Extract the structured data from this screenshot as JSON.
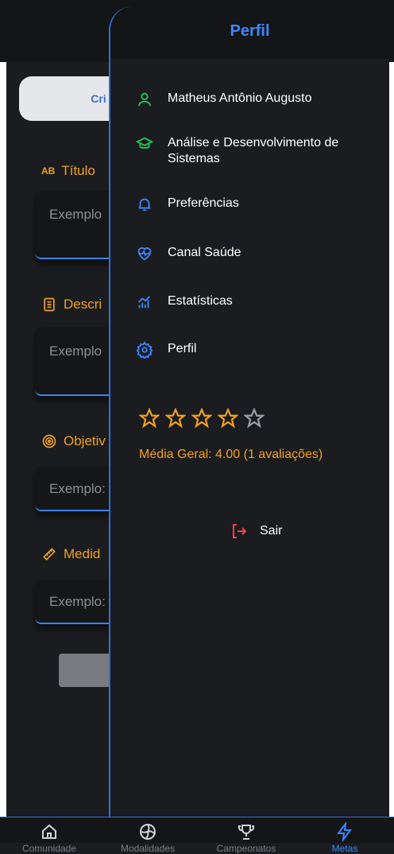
{
  "background_form": {
    "tab_label": "Cri",
    "fields": [
      {
        "label": "Título",
        "placeholder": "Exemplo"
      },
      {
        "label": "Descri",
        "placeholder": "Exemplo"
      },
      {
        "label": "Objetiv",
        "placeholder": "Exemplo:"
      },
      {
        "label": "Medid",
        "placeholder": "Exemplo:"
      }
    ]
  },
  "drawer": {
    "title": "Perfil",
    "items": [
      {
        "icon": "user-icon",
        "label": "Matheus Antônio Augusto"
      },
      {
        "icon": "graduation-cap-icon",
        "label": "Análise e Desenvolvimento de Sistemas"
      },
      {
        "icon": "bell-icon",
        "label": "Preferências"
      },
      {
        "icon": "heart-pulse-icon",
        "label": "Canal Saúde"
      },
      {
        "icon": "stats-icon",
        "label": "Estatísticas"
      },
      {
        "icon": "settings-icon",
        "label": "Perfil"
      }
    ],
    "rating": {
      "stars_filled": 4,
      "stars_total": 5,
      "text": "Média Geral: 4.00 (1 avaliações)"
    },
    "logout_label": "Sair"
  },
  "bottom_nav": {
    "items": [
      {
        "label": "Comunidade",
        "icon": "home-icon"
      },
      {
        "label": "Modalidades",
        "icon": "volleyball-icon"
      },
      {
        "label": "Campeonatos",
        "icon": "trophy-icon"
      },
      {
        "label": "Metas",
        "icon": "lightning-icon",
        "active": true
      }
    ]
  },
  "colors": {
    "accent_blue": "#3d87ff",
    "accent_orange": "#f2a21f",
    "accent_green": "#22c55e",
    "logout_red": "#ef4444",
    "background": "#1b1c1f"
  }
}
